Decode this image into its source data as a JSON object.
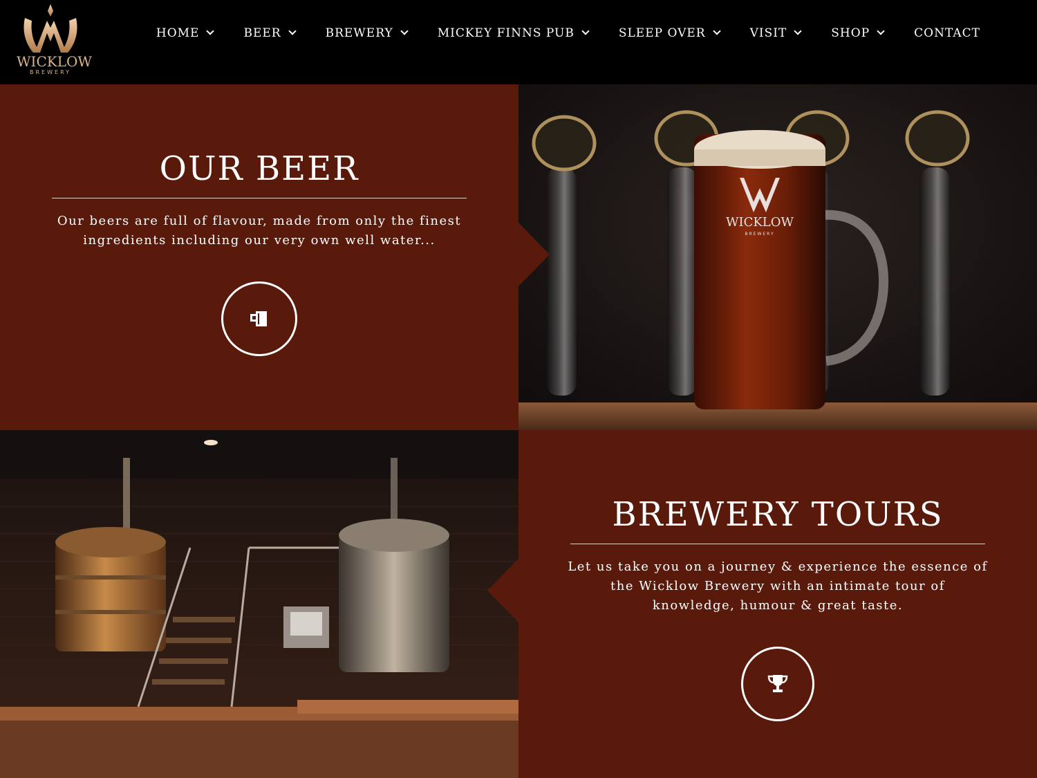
{
  "brand": {
    "name": "WICKLOW",
    "sub": "BREWERY",
    "gold": "#d9b48a"
  },
  "nav": {
    "items": [
      {
        "label": "HOME",
        "dropdown": true
      },
      {
        "label": "BEER",
        "dropdown": true
      },
      {
        "label": "BREWERY",
        "dropdown": true
      },
      {
        "label": "MICKEY FINNS PUB",
        "dropdown": true
      },
      {
        "label": "SLEEP OVER",
        "dropdown": true
      },
      {
        "label": "VISIT",
        "dropdown": true
      },
      {
        "label": "SHOP",
        "dropdown": true
      },
      {
        "label": "CONTACT",
        "dropdown": false
      }
    ]
  },
  "sections": {
    "beer": {
      "title": "OUR BEER",
      "description": "Our beers are full of flavour, made from only the finest ingredients including our very own well water...",
      "icon": "beer-mug-icon"
    },
    "tours": {
      "title": "BREWERY TOURS",
      "description": "Let us take you on a journey & experience the essence of the Wicklow Brewery with an intimate tour of knowledge, humour & great taste.",
      "icon": "trophy-icon"
    }
  },
  "photos": {
    "beer_glass": {
      "glass_brand": "WICKLOW",
      "glass_sub": "BREWERY"
    }
  },
  "colors": {
    "panel_brown": "#5a1a0b",
    "header_black": "#000000",
    "text": "#ffffff"
  }
}
